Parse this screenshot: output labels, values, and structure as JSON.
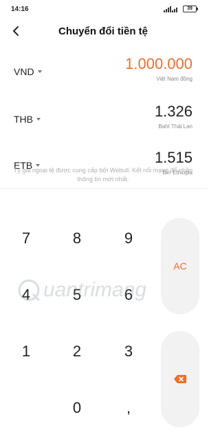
{
  "status_bar": {
    "time": "14:16",
    "battery": "39"
  },
  "header": {
    "title": "Chuyển đổi tiền tệ",
    "back_icon": "chevron-left-icon"
  },
  "currencies": [
    {
      "code": "VND",
      "amount": "1.000.000",
      "name": "Việt Nam đồng",
      "active": true
    },
    {
      "code": "THB",
      "amount": "1.326",
      "name": "Baht Thái Lan",
      "active": false
    },
    {
      "code": "ETB",
      "amount": "1.515",
      "name": "Birr Ethiopia",
      "active": false
    }
  ],
  "note": "Tỷ giá ngoại tệ được cung cấp bởi Webull. Kết nối mạng để nhận thông tin mới nhất.",
  "keypad": {
    "keys": [
      "7",
      "8",
      "9",
      "4",
      "5",
      "6",
      "1",
      "2",
      "3",
      "0",
      ","
    ],
    "clear_label": "AC",
    "backspace_icon": "backspace-icon"
  },
  "watermark": "uantrimang",
  "colors": {
    "accent": "#f06d2b",
    "text": "#222222",
    "muted": "#8a8a8a",
    "key_bg": "#f2f2f2"
  }
}
